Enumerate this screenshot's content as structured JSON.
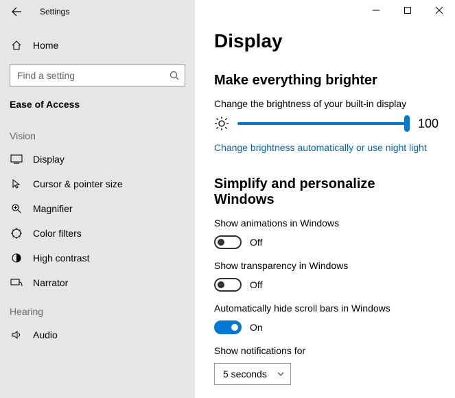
{
  "titlebar": {
    "app_title": "Settings"
  },
  "sidebar": {
    "home_label": "Home",
    "search_placeholder": "Find a setting",
    "section_header": "Ease of Access",
    "groups": [
      {
        "label": "Vision",
        "items": [
          {
            "label": "Display"
          },
          {
            "label": "Cursor & pointer size"
          },
          {
            "label": "Magnifier"
          },
          {
            "label": "Color filters"
          },
          {
            "label": "High contrast"
          },
          {
            "label": "Narrator"
          }
        ]
      },
      {
        "label": "Hearing",
        "items": [
          {
            "label": "Audio"
          }
        ]
      }
    ]
  },
  "main": {
    "page_title": "Display",
    "brightness": {
      "section_title": "Make everything brighter",
      "desc": "Change the brightness of your built-in display",
      "value": "100",
      "link": "Change brightness automatically or use night light"
    },
    "simplify": {
      "section_title": "Simplify and personalize Windows",
      "animations": {
        "label": "Show animations in Windows",
        "state": "Off"
      },
      "transparency": {
        "label": "Show transparency in Windows",
        "state": "Off"
      },
      "scrollbars": {
        "label": "Automatically hide scroll bars in Windows",
        "state": "On"
      },
      "notifications": {
        "label": "Show notifications for",
        "value": "5 seconds"
      }
    }
  },
  "colors": {
    "accent": "#0078d4",
    "link": "#0067c0"
  }
}
